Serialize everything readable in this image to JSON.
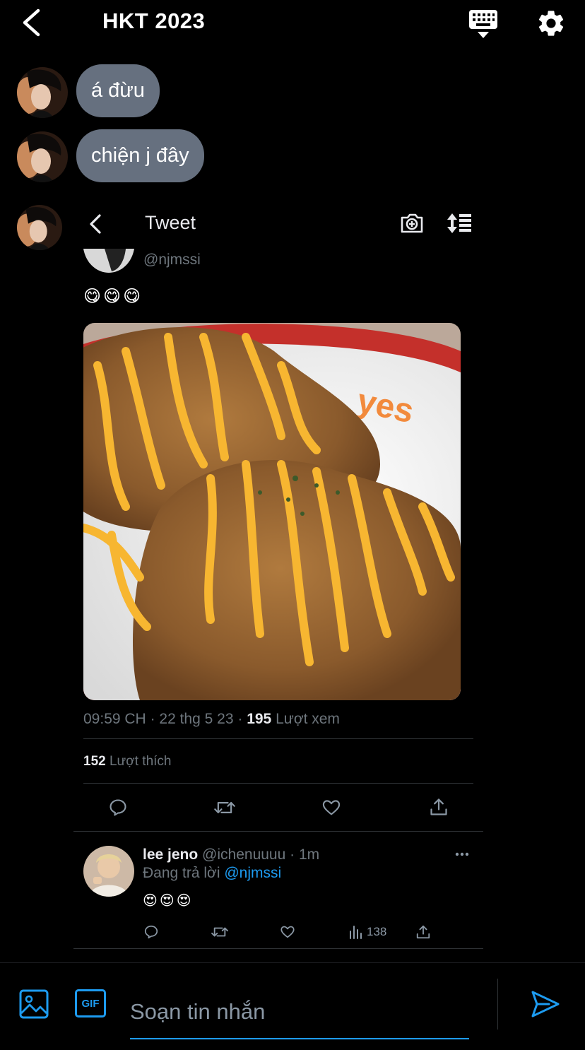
{
  "header": {
    "title": "HKT 2023"
  },
  "messages": [
    {
      "text": "á đừu"
    },
    {
      "text": "chiện j đây"
    }
  ],
  "tweet_card": {
    "title": "Tweet",
    "author_handle": "@njmssi",
    "emojis": [
      "😋",
      "😋",
      "😋"
    ],
    "time": "09:59 CH",
    "sep": "·",
    "date": "22 thg 5 23",
    "views_count": "195",
    "views_label": "Lượt xem",
    "likes_count": "152",
    "likes_label": "Lượt thích",
    "reply": {
      "name": "lee jeno",
      "handle": "@ichenuuuu",
      "time": "1m",
      "replying_prefix": "Đang trả lời",
      "replying_to": "@njmssi",
      "emojis": [
        "😍",
        "😍",
        "😍"
      ],
      "views": "138"
    }
  },
  "composer": {
    "placeholder": "Soạn tin nhắn",
    "gif_label": "GIF"
  },
  "colors": {
    "accent": "#1d9bf0",
    "bubble": "#66707f",
    "muted": "#6e767d"
  }
}
